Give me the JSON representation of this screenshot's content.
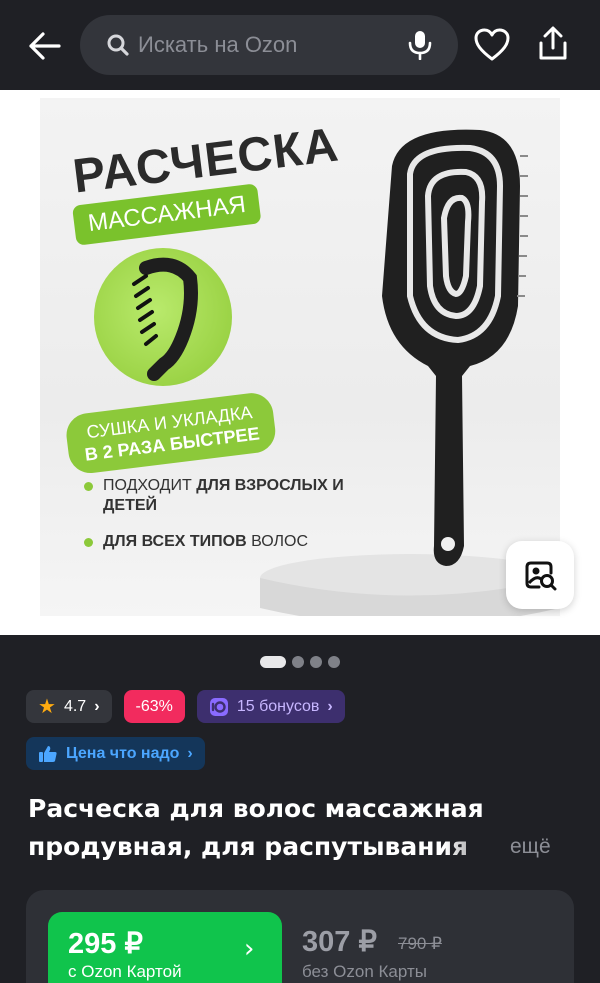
{
  "header": {
    "search_placeholder": "Искать на Ozon"
  },
  "product_image": {
    "title": "РАСЧЕСКА",
    "tag": "МАССАЖНАЯ",
    "badge_line1": "СУШКА И УКЛАДКА",
    "badge_line2": "В 2 РАЗА БЫСТРЕЕ",
    "bullets": [
      {
        "plain": "ПОДХОДИТ ",
        "bold": "ДЛЯ ВЗРОСЛЫХ И ДЕТЕЙ",
        "after": ""
      },
      {
        "plain": "",
        "bold": "ДЛЯ ВСЕХ ТИПОВ",
        "after": " ВОЛОС"
      }
    ],
    "pager_total": 4,
    "pager_active": 1
  },
  "badges": {
    "rating": "4.7",
    "discount": "-63%",
    "bonus": "15 бонусов",
    "price_promo": "Цена что надо"
  },
  "product": {
    "title_line1": "Расческа для волос массажная",
    "title_line2": "продувная, для распутывания",
    "more": "ещё"
  },
  "price": {
    "ozon_price": "295 ₽",
    "ozon_label": "с Ozon Картой",
    "regular_price": "307 ₽",
    "old_price": "790 ₽",
    "regular_label": "без Ozon Карты"
  },
  "colors": {
    "background": "#1f2025",
    "accent_green": "#10c44c",
    "discount_red": "#f22b5e",
    "star": "#ffab10",
    "promo_green": "#8cc93a"
  },
  "icons": [
    "back-arrow-icon",
    "search-icon",
    "microphone-icon",
    "heart-icon",
    "share-icon",
    "image-search-icon",
    "star-icon",
    "bonus-icon",
    "thumbs-up-icon",
    "chevron-right-icon"
  ]
}
